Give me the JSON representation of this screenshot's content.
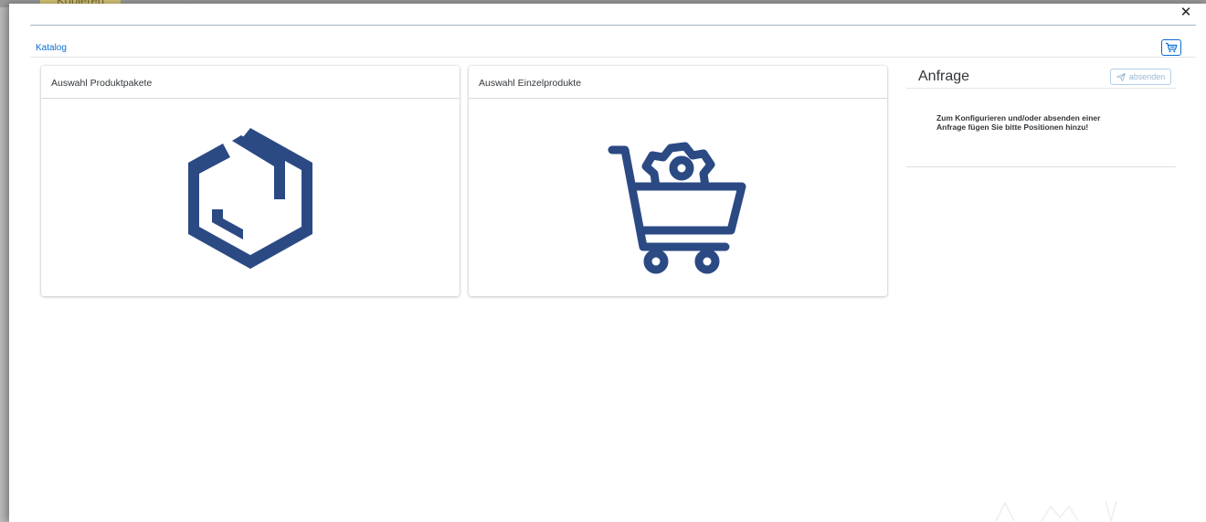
{
  "background": {
    "button_label": "Kopieren",
    "faded_label": "…"
  },
  "dialog": {
    "close_icon": "close-icon",
    "breadcrumb": "Katalog",
    "cart_icon": "cart-icon"
  },
  "cards": [
    {
      "title": "Auswahl Produktpakete",
      "icon": "package-hexagon-icon"
    },
    {
      "title": "Auswahl Einzelprodukte",
      "icon": "cart-gear-icon"
    }
  ],
  "request_panel": {
    "title": "Anfrage",
    "send_label": "absenden",
    "send_icon": "paper-plane-icon",
    "message_line1": "Zum Konfigurieren und/oder absenden einer",
    "message_line2": "Anfrage fügen Sie bitte Positionen hinzu!"
  },
  "colors": {
    "accent": "#0a6ed1",
    "icon_navy": "#2b4a84",
    "text": "#32363a"
  }
}
